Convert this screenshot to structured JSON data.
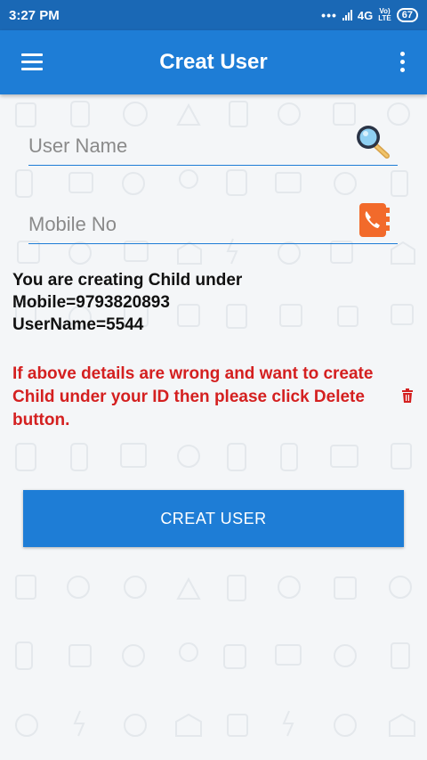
{
  "status_bar": {
    "time": "3:27 PM",
    "dots": "•••",
    "network": "4G",
    "volte_top": "Vo)",
    "volte_bottom": "LTE",
    "battery": "67"
  },
  "app_bar": {
    "title": "Creat User"
  },
  "form": {
    "username_placeholder": "User Name",
    "username_value": "",
    "mobile_placeholder": "Mobile No",
    "mobile_value": ""
  },
  "info": {
    "line1": "You are creating Child under",
    "line2": "Mobile=9793820893",
    "line3": "UserName=5544"
  },
  "warning": {
    "text": "If above details are wrong and want to create Child under your ID then please click Delete button."
  },
  "actions": {
    "create_label": "CREAT USER"
  },
  "colors": {
    "primary": "#1e7dd6",
    "status_bar": "#1a68b5",
    "warning": "#d42020",
    "contact_icon": "#f26a2b"
  },
  "icons": [
    "menu-icon",
    "overflow-icon",
    "search-icon",
    "contact-book-icon",
    "trash-icon"
  ]
}
